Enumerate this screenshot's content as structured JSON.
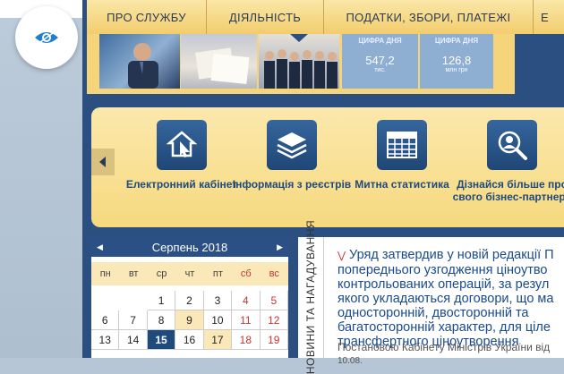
{
  "nav": {
    "items": [
      "ПРО СЛУЖБУ",
      "ДІЯЛЬНІСТЬ",
      "ПОДАТКИ, ЗБОРИ, ПЛАТЕЖІ",
      "Е"
    ]
  },
  "banner": {
    "tile1_label": "ЦИФРА ДНЯ",
    "tile1_value": "547,2",
    "tile1_unit": "тис.",
    "tile2_label": "ЦИФРА ДНЯ",
    "tile2_value": "126,8",
    "tile2_unit": "млн грн"
  },
  "services": [
    {
      "label": "Електронний кабінет",
      "icon": "house-cursor-icon"
    },
    {
      "label": "Інформація з реєстрів",
      "icon": "layers-icon"
    },
    {
      "label": "Митна статистика",
      "icon": "table-icon"
    },
    {
      "label": "Дізнайся більше про свого бізнес-партнера",
      "icon": "search-person-icon"
    }
  ],
  "calendar": {
    "month": "Серпень 2018",
    "dow": [
      "пн",
      "вт",
      "ср",
      "чт",
      "пт",
      "сб",
      "вс"
    ],
    "weeks": [
      [
        "",
        "",
        "1",
        "2",
        "3",
        "4",
        "5"
      ],
      [
        "6",
        "7",
        "8",
        "9",
        "10",
        "11",
        "12"
      ],
      [
        "13",
        "14",
        "15",
        "16",
        "17",
        "18",
        "19"
      ]
    ],
    "today": "15",
    "highlighted": [
      "9",
      "17"
    ]
  },
  "news": {
    "tab_label": "НОВИНИ ТА НАГАДУВАННЯ",
    "title": "Уряд затвердив у новій редакції П попереднього узгодження ціноутво контрольованих операцій, за резул якого укладаються договори, що ма односторонній, двосторонній та багатосторонній характер, для ціле трансфертного ціноутворення",
    "date": "10.08.",
    "text": "Постановою Кабінету Міністрів України від"
  }
}
